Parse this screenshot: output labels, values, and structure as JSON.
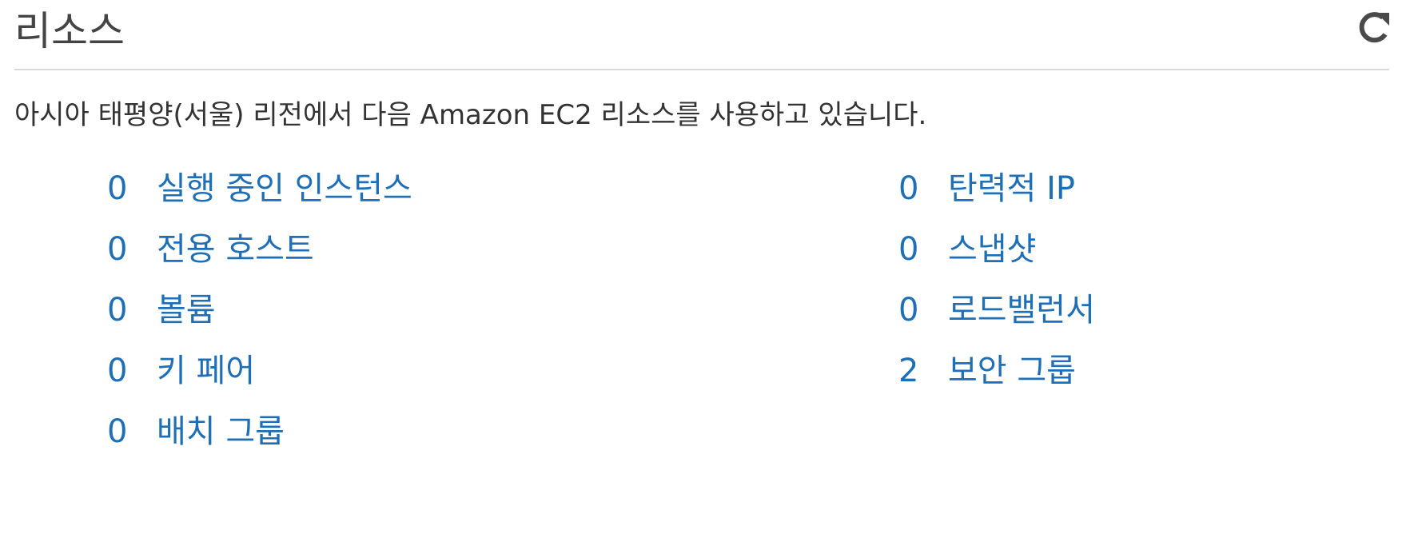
{
  "header": {
    "title": "리소스",
    "refresh_icon": "refresh-icon"
  },
  "description": "아시아 태평양(서울) 리전에서 다음 Amazon EC2 리소스를 사용하고 있습니다.",
  "resources_left": [
    {
      "count": "0",
      "label": "실행 중인 인스턴스"
    },
    {
      "count": "0",
      "label": "전용 호스트"
    },
    {
      "count": "0",
      "label": "볼륨"
    },
    {
      "count": "0",
      "label": "키 페어"
    },
    {
      "count": "0",
      "label": "배치 그룹"
    }
  ],
  "resources_right": [
    {
      "count": "0",
      "label": "탄력적 IP"
    },
    {
      "count": "0",
      "label": "스냅샷"
    },
    {
      "count": "0",
      "label": "로드밸런서"
    },
    {
      "count": "2",
      "label": "보안 그룹"
    }
  ],
  "colors": {
    "link": "#1f6fb7",
    "divider": "#d9d9d9",
    "text": "#333333"
  }
}
